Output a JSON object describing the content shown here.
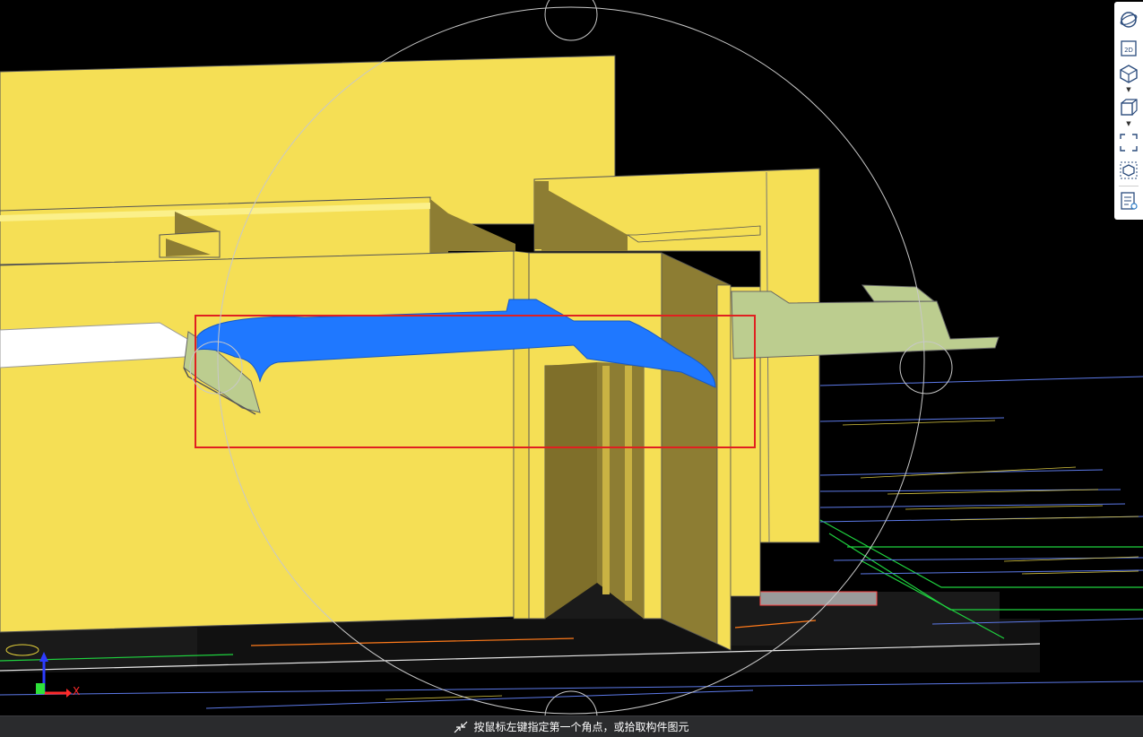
{
  "status_bar": {
    "prompt": "按鼠标左键指定第一个角点，或拾取构件图元"
  },
  "axis_gizmo": {
    "x_label": "X"
  },
  "view_toolbar": {
    "buttons": [
      {
        "icon": "orbit-icon"
      },
      {
        "icon": "view-2d-icon",
        "label": "2D"
      },
      {
        "icon": "view-3d-icon"
      },
      {
        "icon": "box-display-icon"
      },
      {
        "icon": "zoom-extents-icon"
      },
      {
        "icon": "isolate-component-icon"
      },
      {
        "icon": "layer-display-icon"
      }
    ]
  },
  "colors": {
    "wall": "#f5df55",
    "wall_shade": "#8d7d33",
    "selected_duct": "#1f78ff",
    "duct": "#bccd8f",
    "selection_box": "#e02020",
    "orbit_guide": "#c8c8c8",
    "plan_lines_cyan": "#5c79e8",
    "plan_lines_green": "#1fd33f"
  }
}
